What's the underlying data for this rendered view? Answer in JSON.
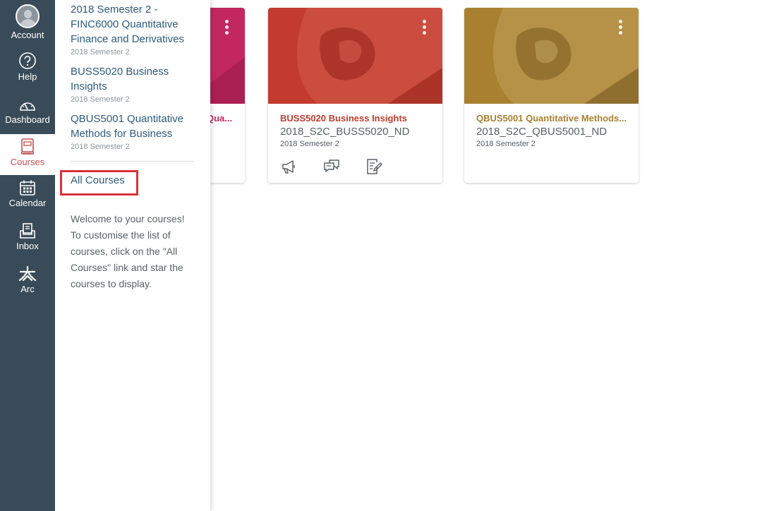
{
  "global_nav": {
    "items": [
      {
        "id": "account",
        "label": "Account",
        "icon": "avatar-icon",
        "active": false
      },
      {
        "id": "help",
        "label": "Help",
        "icon": "help-circle-icon",
        "active": false
      },
      {
        "id": "dashboard",
        "label": "Dashboard",
        "icon": "speedometer-icon",
        "active": false
      },
      {
        "id": "courses",
        "label": "Courses",
        "icon": "book-icon",
        "active": true
      },
      {
        "id": "calendar",
        "label": "Calendar",
        "icon": "calendar-icon",
        "active": false
      },
      {
        "id": "inbox",
        "label": "Inbox",
        "icon": "inbox-icon",
        "active": false
      },
      {
        "id": "arc",
        "label": "Arc",
        "icon": "arc-icon",
        "active": false
      }
    ],
    "colors": {
      "background": "#394b58",
      "active_accent": "#c0504d"
    }
  },
  "courses_tray": {
    "courses": [
      {
        "name": "2018 Semester 2 - FINC6000 Quantitative Finance and Derivatives",
        "term": "2018 Semester 2"
      },
      {
        "name": "BUSS5020 Business Insights",
        "term": "2018 Semester 2"
      },
      {
        "name": "QBUS5001 Quantitative Methods for Business",
        "term": "2018 Semester 2"
      }
    ],
    "all_courses_label": "All Courses",
    "welcome_text": "Welcome to your courses! To customise the list of courses, click on the \"All Courses\" link and star the courses to display.",
    "highlight_color": "#d9323a"
  },
  "dashboard_cards": [
    {
      "title": "Qua...",
      "code": "",
      "term": "",
      "color": "#c2285f",
      "partially_hidden": true,
      "actions": []
    },
    {
      "title": "BUSS5020 Business Insights",
      "code": "2018_S2C_BUSS5020_ND",
      "term": "2018 Semester 2",
      "color": "#c23b2e",
      "actions": [
        {
          "icon": "announcements-icon"
        },
        {
          "icon": "discussions-icon"
        },
        {
          "icon": "assignments-icon"
        }
      ]
    },
    {
      "title": "QBUS5001 Quantitative Methods...",
      "code": "2018_S2C_QBUS5001_ND",
      "term": "2018 Semester 2",
      "color": "#a8802f",
      "actions": []
    }
  ]
}
